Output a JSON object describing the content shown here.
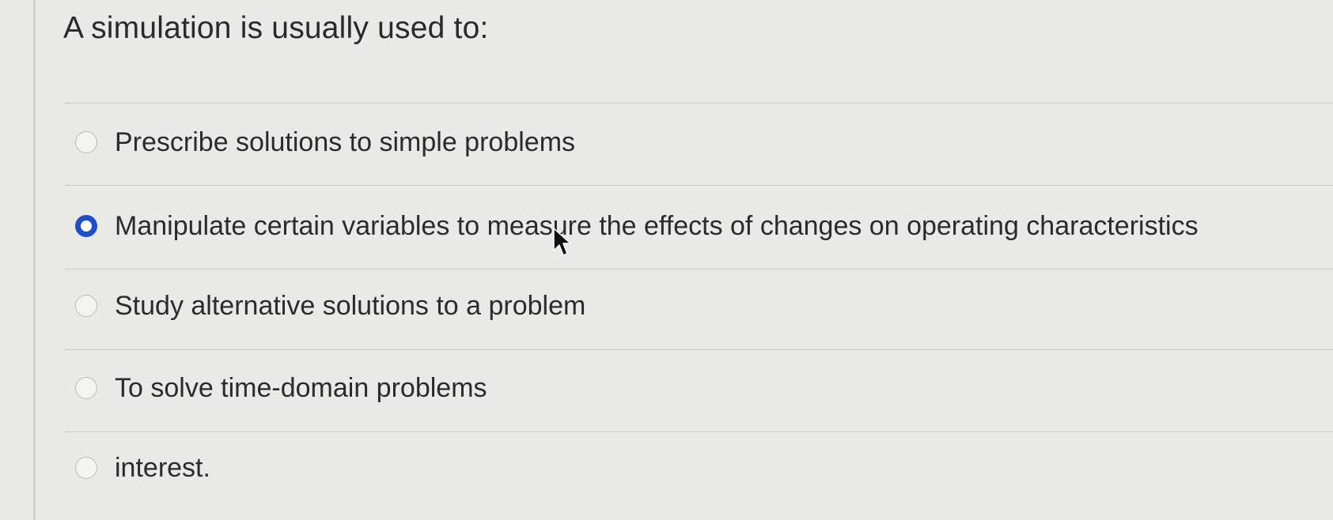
{
  "question": {
    "title": "A simulation is usually used to:"
  },
  "options": [
    {
      "label": "Prescribe solutions to simple problems",
      "selected": false
    },
    {
      "label": "Manipulate certain variables to measure the effects of changes on operating characteristics",
      "selected": true
    },
    {
      "label": "Study alternative solutions to a problem",
      "selected": false
    },
    {
      "label": "To solve time-domain problems",
      "selected": false
    },
    {
      "label": "interest.",
      "selected": false
    }
  ],
  "colors": {
    "selected_radio": "#1f4fc8",
    "background": "#e9e9e8"
  },
  "icons": {
    "radio": "radio-button-icon",
    "cursor": "mouse-pointer-icon"
  }
}
